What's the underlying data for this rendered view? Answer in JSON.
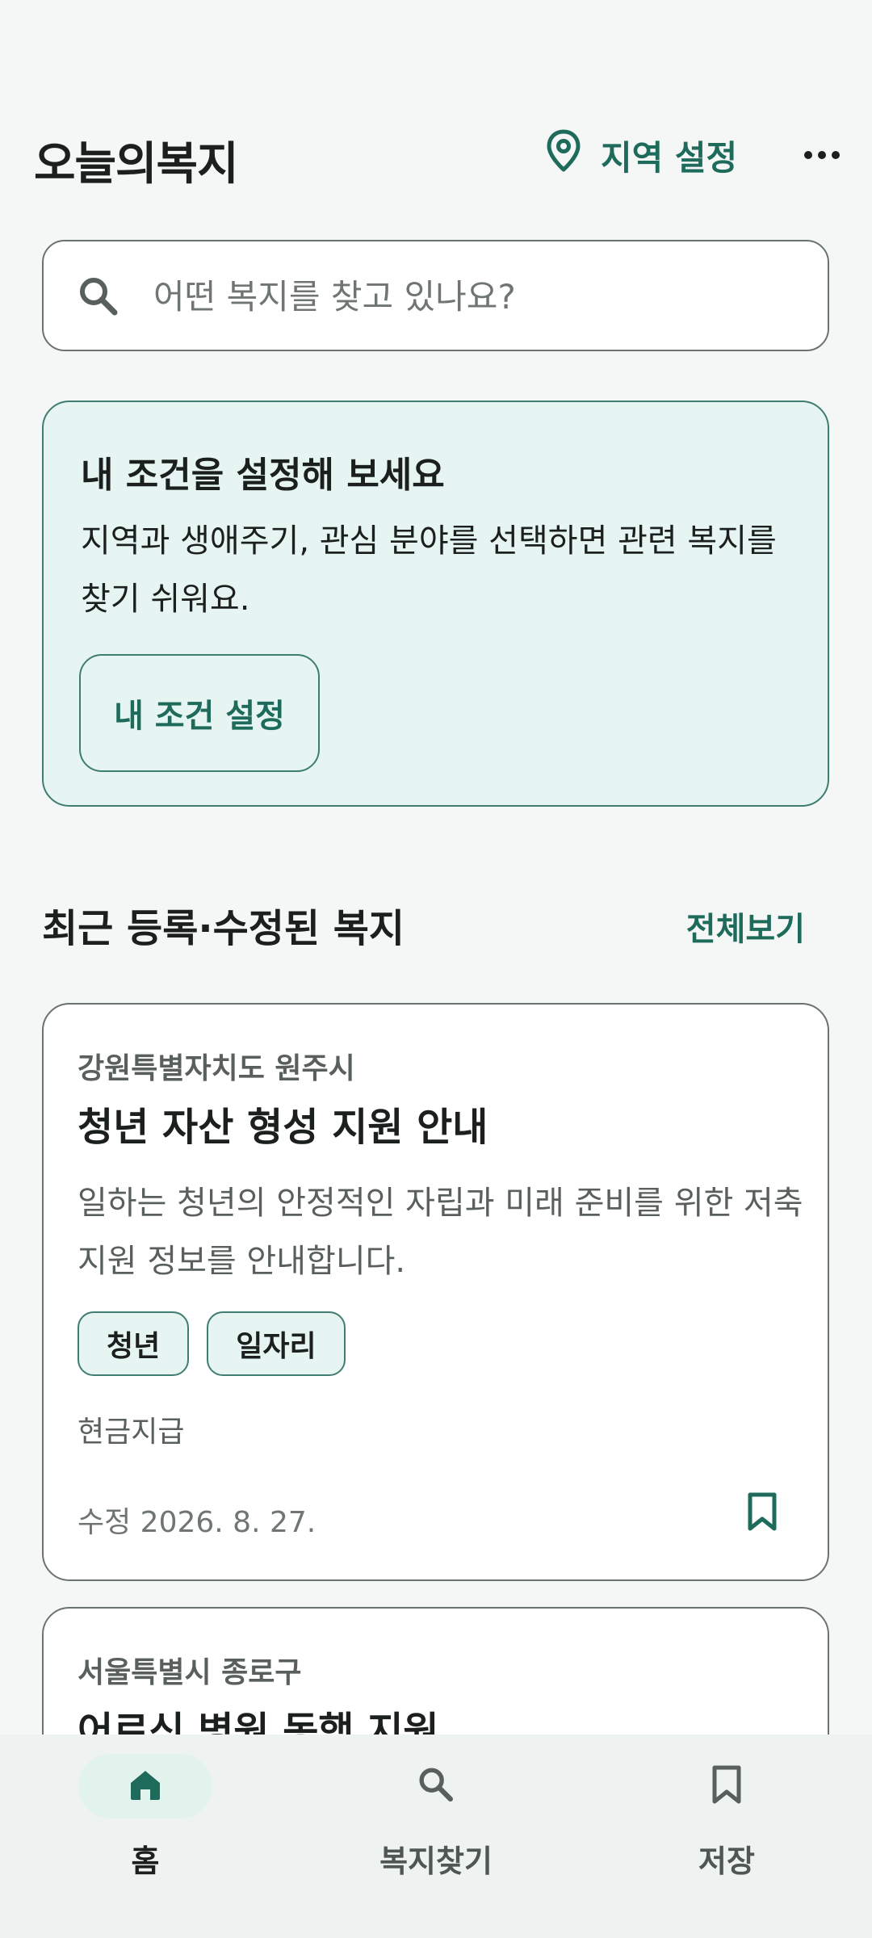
{
  "header": {
    "title": "오늘의복지",
    "region_label": "지역 설정",
    "icons": {
      "region": "map-pin-icon",
      "more": "more-horizontal-icon"
    }
  },
  "search": {
    "placeholder": "어떤 복지를 찾고 있나요?",
    "value": "",
    "icon": "search-icon"
  },
  "promo": {
    "title": "내 조건을 설정해 보세요",
    "description": "지역과 생애주기, 관심 분야를 선택하면 관련 복지를 찾기 쉬워요.",
    "button_label": "내 조건 설정"
  },
  "recent": {
    "section_title": "최근 등록·수정된 복지",
    "see_all_label": "전체보기",
    "items": [
      {
        "region": "강원특별자치도 원주시",
        "title": "청년 자산 형성 지원 안내",
        "description": "일하는 청년의 안정적인 자립과 미래 준비를 위한 저축 지원 정보를 안내합니다.",
        "tags": [
          "청년",
          "일자리"
        ],
        "support_type": "현금지급",
        "updated": "수정 2026. 8. 27.",
        "bookmark_icon": "bookmark-icon"
      },
      {
        "region": "서울특별시 종로구",
        "title": "어르신 병원 동행 지원"
      }
    ]
  },
  "bottom_nav": {
    "items": [
      {
        "label": "홈",
        "icon": "home-icon",
        "active": true
      },
      {
        "label": "복지찾기",
        "icon": "search-icon",
        "active": false
      },
      {
        "label": "저장",
        "icon": "bookmark-icon",
        "active": false
      }
    ]
  },
  "colors": {
    "background": "#f5f7f6",
    "accent": "#1e6b5c",
    "promo_bg": "#e6f5f1",
    "card_border": "#6b7371",
    "text": "#1b1f1e",
    "muted_text": "#585f5d",
    "nav_bg": "#eef2f1"
  }
}
